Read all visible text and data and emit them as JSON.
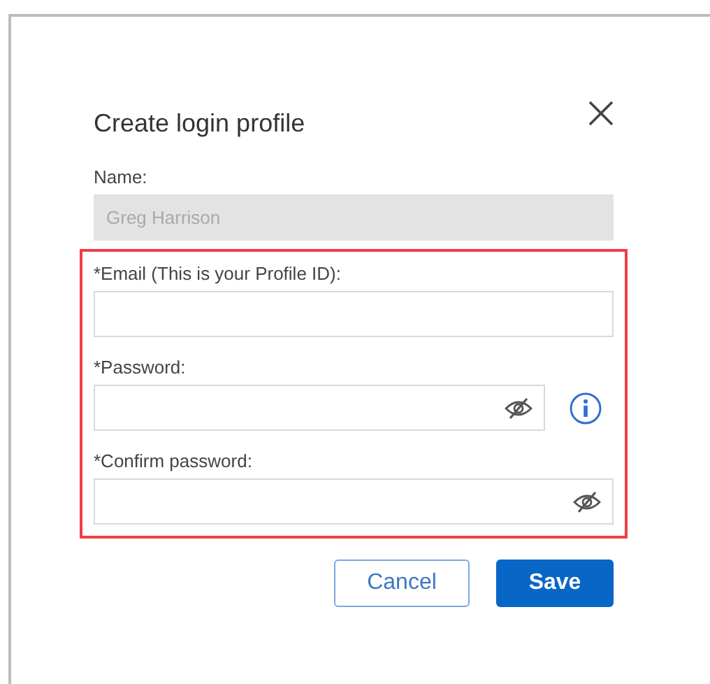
{
  "dialog": {
    "title": "Create login profile"
  },
  "name_field": {
    "label": "Name:",
    "value": "Greg Harrison",
    "disabled": true
  },
  "required_fields": {
    "highlighted": true,
    "fields": [
      {
        "kind": "text",
        "label": "*Email (This is your Profile ID):",
        "info": false
      },
      {
        "kind": "password",
        "label": "*Password:",
        "info": true
      },
      {
        "kind": "password",
        "label": "*Confirm password:",
        "info": false
      }
    ]
  },
  "buttons": [
    {
      "kind": "secondary",
      "label": "Cancel"
    },
    {
      "kind": "primary",
      "label": "Save"
    }
  ]
}
